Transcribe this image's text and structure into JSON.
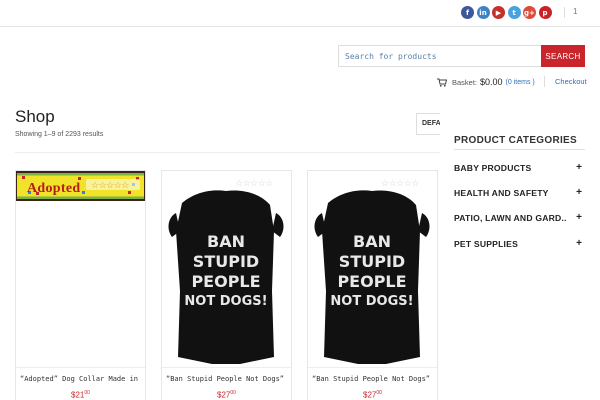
{
  "header": {
    "social": [
      {
        "icon": "facebook-icon",
        "glyph": "f",
        "color": "#3b5998"
      },
      {
        "icon": "linkedin-icon",
        "glyph": "in",
        "color": "#3f83c6"
      },
      {
        "icon": "youtube-icon",
        "glyph": "▶",
        "color": "#c4302b"
      },
      {
        "icon": "twitter-icon",
        "glyph": "t",
        "color": "#4aa3df"
      },
      {
        "icon": "google-plus-icon",
        "glyph": "g+",
        "color": "#dd4b39"
      },
      {
        "icon": "pinterest-icon",
        "glyph": "p",
        "color": "#cb2027"
      }
    ],
    "top_count": "1",
    "search": {
      "placeholder": "Search for products",
      "button_label": "SEARCH"
    },
    "basket": {
      "label": "Basket:",
      "amount": "$0.00",
      "items": "(0 items )",
      "cart_icon": "cart-icon"
    },
    "checkout_label": "Checkout"
  },
  "shop": {
    "title": "Shop",
    "result_count": "Showing 1–9 of 2293 results",
    "sort_label": "DEFAULT SORTING"
  },
  "products": [
    {
      "title": "“Adopted” Dog Collar Made in the USA",
      "price_main": "$21",
      "price_cents": "00"
    },
    {
      "title": "“Ban Stupid People Not Dogs” Dog Shirt",
      "price_main": "$27",
      "price_cents": "00"
    },
    {
      "title": "“Ban Stupid People Not Dogs” Dog Shirt",
      "price_main": "$27",
      "price_cents": "00"
    }
  ],
  "shirt_print": [
    "BAN",
    "STUPID",
    "PEOPLE",
    "NOT DOGS!"
  ],
  "collar_print": "Adopted",
  "sidebar": {
    "heading": "PRODUCT CATEGORIES",
    "categories": [
      {
        "label": "BABY PRODUCTS",
        "toggle": "+"
      },
      {
        "label": "HEALTH AND SAFETY",
        "toggle": "+"
      },
      {
        "label": "PATIO, LAWN AND GARD..",
        "toggle": "+"
      },
      {
        "label": "PET SUPPLIES",
        "toggle": "+"
      }
    ]
  },
  "colors": {
    "accent": "#c8252c",
    "link": "#2f6fb5"
  }
}
